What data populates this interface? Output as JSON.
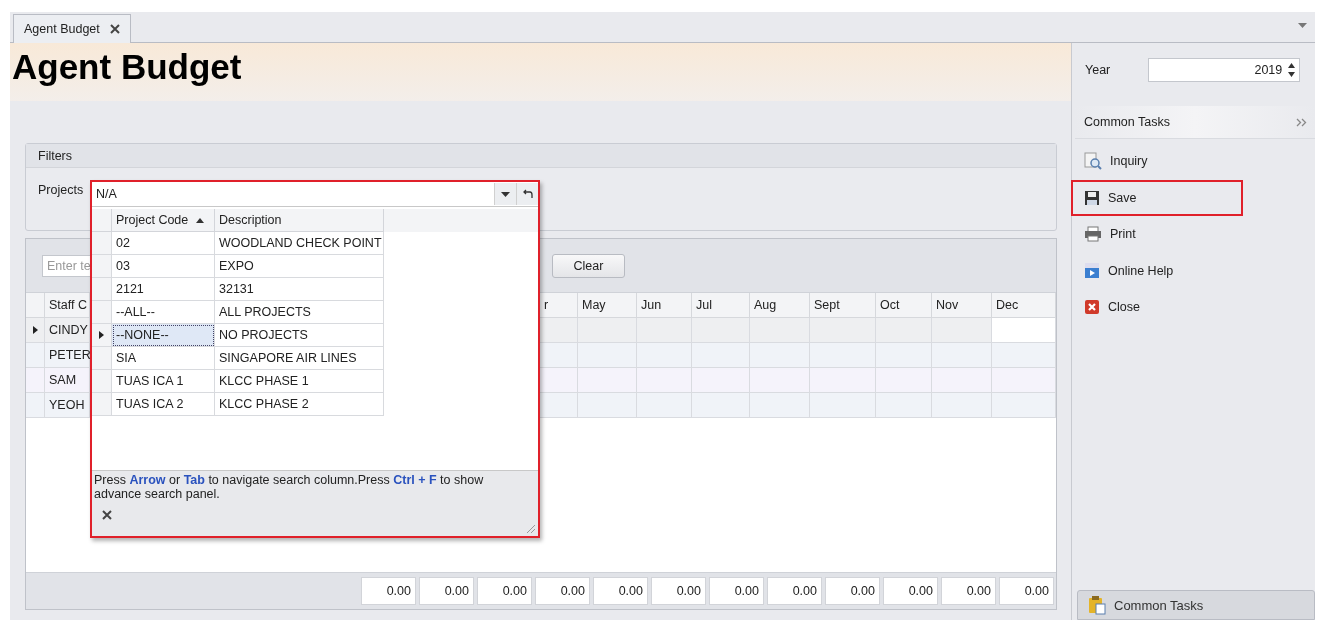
{
  "tab": {
    "label": "Agent Budget"
  },
  "page_title": "Agent Budget",
  "filters": {
    "title": "Filters",
    "projects_label": "Projects"
  },
  "grid": {
    "search_placeholder": "Enter te",
    "clear_button": "Clear",
    "columns": [
      "Staff C",
      "r",
      "May",
      "Jun",
      "Jul",
      "Aug",
      "Sept",
      "Oct",
      "Nov",
      "Dec"
    ],
    "rows": [
      {
        "staff": "CINDY",
        "selected": true
      },
      {
        "staff": "PETER",
        "selected": false
      },
      {
        "staff": "SAM",
        "selected": false
      },
      {
        "staff": "YEOH",
        "selected": false
      }
    ],
    "totals": [
      "0.00",
      "0.00",
      "0.00",
      "0.00",
      "0.00",
      "0.00",
      "0.00",
      "0.00",
      "0.00",
      "0.00",
      "0.00",
      "0.00"
    ]
  },
  "lookup": {
    "value": "N/A",
    "highlighted": true,
    "columns": [
      {
        "label": "Project Code",
        "sorted": true
      },
      {
        "label": "Description",
        "sorted": false
      }
    ],
    "rows": [
      {
        "code": "02",
        "description": "WOODLAND CHECK POINT",
        "selected": false
      },
      {
        "code": "03",
        "description": "EXPO",
        "selected": false
      },
      {
        "code": "2121",
        "description": "32131",
        "selected": false
      },
      {
        "code": "--ALL--",
        "description": "ALL PROJECTS",
        "selected": false
      },
      {
        "code": "--NONE--",
        "description": "NO PROJECTS",
        "selected": true
      },
      {
        "code": "SIA",
        "description": "SINGAPORE AIR LINES",
        "selected": false
      },
      {
        "code": "TUAS ICA 1",
        "description": "KLCC PHASE 1",
        "selected": false
      },
      {
        "code": "TUAS ICA 2",
        "description": "KLCC PHASE 2",
        "selected": false
      }
    ],
    "hint": "Press **Arrow** or **Tab** to navigate search column.Press **Ctrl + F** to show advance search panel."
  },
  "side": {
    "year_label": "Year",
    "year": "2019",
    "tasks_title": "Common Tasks",
    "tasks": [
      {
        "kind": "inquiry",
        "label": "Inquiry",
        "highlighted": false
      },
      {
        "kind": "save",
        "label": "Save",
        "highlighted": true
      },
      {
        "kind": "print",
        "label": "Print",
        "highlighted": false
      },
      {
        "kind": "help",
        "label": "Online Help",
        "highlighted": false
      },
      {
        "kind": "close",
        "label": "Close",
        "highlighted": false
      }
    ],
    "nav_button": "Common Tasks"
  }
}
